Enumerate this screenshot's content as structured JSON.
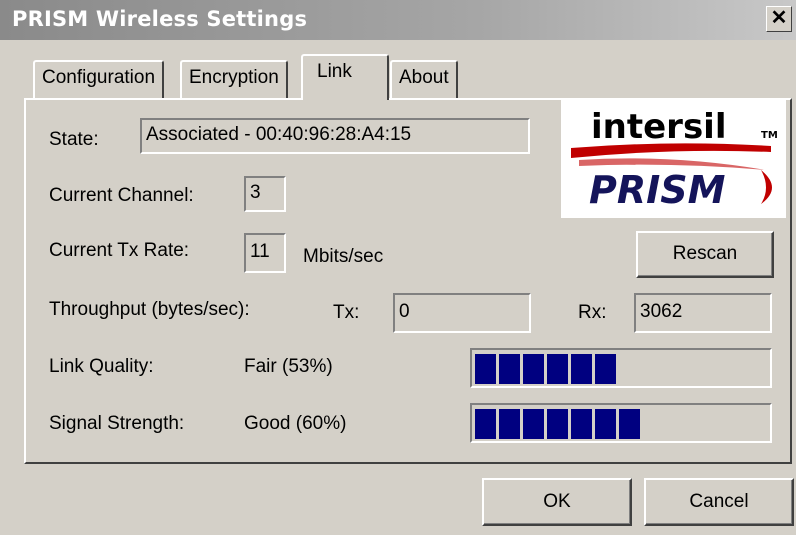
{
  "window": {
    "title": "PRISM Wireless Settings",
    "close_glyph": "✕"
  },
  "tabs": [
    {
      "label": "Configuration",
      "active": false
    },
    {
      "label": "Encryption",
      "active": false
    },
    {
      "label": "Link",
      "active": true
    },
    {
      "label": "About",
      "active": false
    }
  ],
  "logo": {
    "brand_top": "intersil",
    "brand_bottom": "PRISM"
  },
  "state": {
    "label": "State:",
    "value": "Associated - 00:40:96:28:A4:15"
  },
  "channel": {
    "label": "Current Channel:",
    "value": "3"
  },
  "tx_rate": {
    "label": "Current Tx Rate:",
    "value": "11",
    "unit": "Mbits/sec"
  },
  "rescan_label": "Rescan",
  "throughput": {
    "label": "Throughput (bytes/sec):",
    "tx_label": "Tx:",
    "tx_value": "0",
    "rx_label": "Rx:",
    "rx_value": "3062"
  },
  "link_quality": {
    "label": "Link Quality:",
    "value": "Fair (53%)",
    "level": 0.53
  },
  "signal_strength": {
    "label": "Signal Strength:",
    "value": "Good (60%)",
    "level": 0.6
  },
  "buttons": {
    "ok_label": "OK",
    "cancel_label": "Cancel"
  },
  "colors": {
    "progress_fill": "#000080",
    "face": "#d4d0c8"
  }
}
